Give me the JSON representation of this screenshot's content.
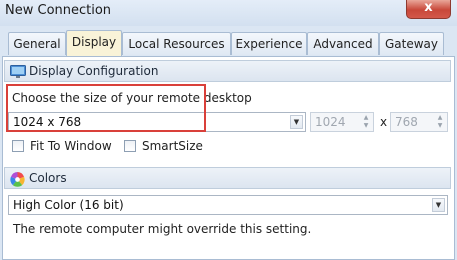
{
  "window": {
    "title": "New Connection",
    "close_glyph": "x"
  },
  "tabs": [
    {
      "label": "General",
      "active": false
    },
    {
      "label": "Display",
      "active": true
    },
    {
      "label": "Local Resources",
      "active": false
    },
    {
      "label": "Experience",
      "active": false
    },
    {
      "label": "Advanced",
      "active": false
    },
    {
      "label": "Gateway",
      "active": false
    }
  ],
  "display_config": {
    "header": "Display Configuration",
    "icon": "monitor-icon",
    "size_label": "Choose the size of your remote desktop",
    "size_value": "1024 x 768",
    "width_value": "1024",
    "separator": "x",
    "height_value": "768",
    "fit_to_window_label": "Fit To Window",
    "fit_to_window_checked": false,
    "smartsize_label": "SmartSize",
    "smartsize_checked": false
  },
  "colors": {
    "header": "Colors",
    "icon": "color-wheel-icon",
    "value": "High Color (16 bit)",
    "note": "The remote computer might override this setting."
  },
  "accent": {
    "highlight": "#d9403a",
    "active_tab": "#f9f3d8",
    "chrome": "#dbe6f3"
  }
}
